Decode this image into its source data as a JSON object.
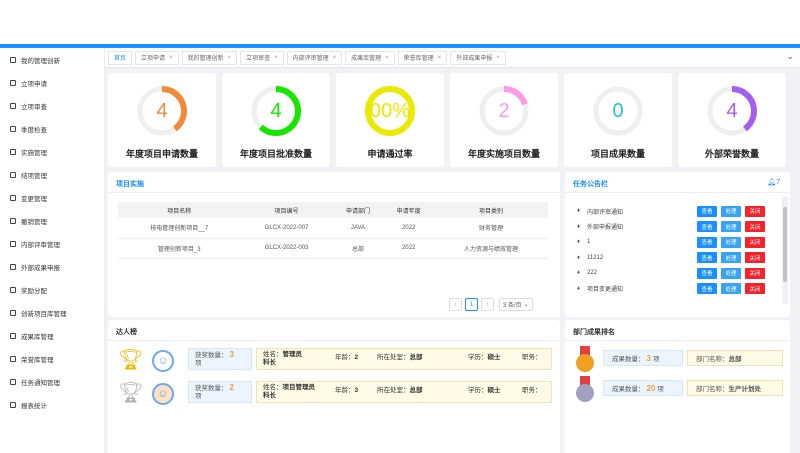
{
  "sidebar": {
    "items": [
      "我的管理创新",
      "立项申请",
      "立项审查",
      "季度检查",
      "实施管理",
      "结项管理",
      "变更管理",
      "撤销管理",
      "内部评审管理",
      "外部成果申报",
      "奖励分配",
      "创新项目库管理",
      "成果库管理",
      "荣誉库管理",
      "任务通知管理",
      "报表统计"
    ]
  },
  "tabs": [
    {
      "label": "首页",
      "closable": false
    },
    {
      "label": "立项申请",
      "closable": true
    },
    {
      "label": "我的管理创新",
      "closable": true
    },
    {
      "label": "立项审查",
      "closable": true
    },
    {
      "label": "内部评审管理",
      "closable": true
    },
    {
      "label": "成果库管理",
      "closable": true
    },
    {
      "label": "荣誉库管理",
      "closable": true
    },
    {
      "label": "外部成果申报",
      "closable": true
    }
  ],
  "tabs_more": "⌄",
  "stats": [
    {
      "value": "4",
      "label": "年度项目申请数量",
      "color": "#f38a3a",
      "fill": 0.4
    },
    {
      "value": "4",
      "label": "年度项目批准数量",
      "color": "#16e600",
      "fill": 0.62
    },
    {
      "value": "00%",
      "label": "申请通过率",
      "color": "#e9ea00",
      "fill": 1.0
    },
    {
      "value": "2",
      "label": "年度实施项目数量",
      "color": "#ff99e8",
      "fill": 0.2
    },
    {
      "value": "0",
      "label": "项目成果数量",
      "color": "#26c6c6",
      "fill": 0.0
    },
    {
      "value": "4",
      "label": "外部荣誉数量",
      "color": "#a45ef0",
      "fill": 0.4
    }
  ],
  "projects": {
    "title": "项目实施",
    "columns": [
      "项目名称",
      "项目编号",
      "申请部门",
      "申请年度",
      "项目类别"
    ],
    "rows": [
      [
        "核电管理创新项目__7",
        "GLCX-2022-007",
        "JAVA",
        "2022",
        "财务管理"
      ],
      [
        "管理创新项目_3",
        "GLCX-2022-003",
        "总部",
        "2022",
        "人力资源与绩效管理"
      ]
    ],
    "pager": {
      "prev": "‹",
      "page": "1",
      "next": "›",
      "size": "3 条/页"
    }
  },
  "notices": {
    "title": "任务公告栏",
    "count": "7",
    "items": [
      "内部评审通知",
      "外部申报通知",
      "1",
      "11212",
      "222",
      "项目变更通知"
    ],
    "btn_view": "查看",
    "btn_handle": "处理",
    "btn_close": "关闭"
  },
  "experts": {
    "title": "达人榜",
    "rows": [
      {
        "award_label": "获奖数量：",
        "award_count": "3",
        "award_unit": "项",
        "name_label": "姓名：",
        "name": "管理员",
        "name2": "科长",
        "age_label": "年龄：",
        "age": "2",
        "office_label": "所在处室：",
        "office": "总部",
        "edu_label": "学历：",
        "edu": "硕士",
        "job_label": "职务："
      },
      {
        "award_label": "获奖数量：",
        "award_count": "2",
        "award_unit": "项",
        "name_label": "姓名：",
        "name": "项目管理员",
        "name2": "科长",
        "age_label": "年龄：",
        "age": "3",
        "office_label": "所在处室：",
        "office": "总部",
        "edu_label": "学历：",
        "edu": "硕士",
        "job_label": "职务："
      }
    ]
  },
  "dept": {
    "title": "部门成果排名",
    "rows": [
      {
        "count_label": "成果数量：",
        "count": "3",
        "unit": "项",
        "dept_label": "部门名称：",
        "dept": "总部"
      },
      {
        "count_label": "成果数量：",
        "count": "20",
        "unit": "项",
        "dept_label": "部门名称：",
        "dept": "生产计划处"
      }
    ]
  }
}
